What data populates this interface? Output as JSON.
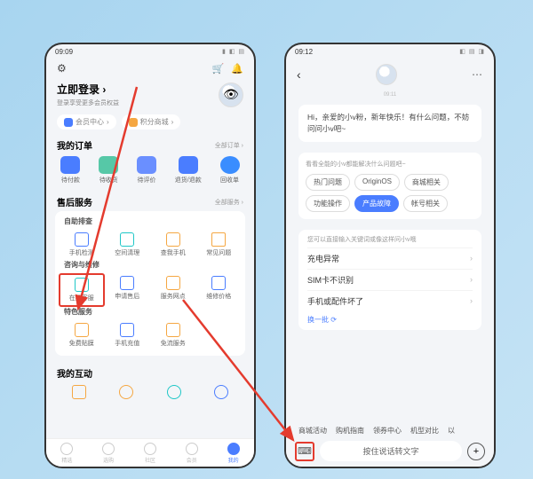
{
  "left": {
    "status_time": "09:09",
    "login_title": "立即登录",
    "login_sub": "登录享受更多会员权益",
    "pill_member": "会员中心",
    "pill_points": "积分商城",
    "orders_title": "我的订单",
    "orders_more": "全部订单 ›",
    "orders": [
      "待付款",
      "待收货",
      "待评价",
      "退货/退款",
      "回收单"
    ],
    "aftersale_title": "售后服务",
    "aftersale_more": "全部服务 ›",
    "group1_label": "自助排查",
    "group1": [
      "手机检测",
      "空间清理",
      "查我手机",
      "常见问题"
    ],
    "group2_label": "咨询与维修",
    "group2": [
      "在线客服",
      "申请售后",
      "服务网点",
      "维修价格"
    ],
    "group3_label": "特色服务",
    "group3": [
      "免费贴膜",
      "手机充值",
      "免流服务"
    ],
    "interact_title": "我的互动",
    "nav": [
      "精选",
      "选购",
      "社区",
      "会员",
      "我的"
    ]
  },
  "right": {
    "status_time": "09:12",
    "chat_time": "09:11",
    "greeting": "Hi，亲爱的小v粉，新年快乐！有什么问题，不妨问问小v吧~",
    "chips_title": "看看全能的小v都能解决什么问题吧~",
    "chips": [
      "热门问题",
      "OriginOS",
      "商城相关",
      "功能操作",
      "产品故障",
      "帐号相关"
    ],
    "sugg_title": "您可以直接输入关键词或像这样问小v哦",
    "suggestions": [
      "充电异常",
      "SIM卡不识别",
      "手机或配件坏了"
    ],
    "refresh": "换一批",
    "bottom_chips": [
      "商城活动",
      "购机指南",
      "领券中心",
      "机型对比",
      "以"
    ],
    "voice_label": "按住说话转文字"
  }
}
